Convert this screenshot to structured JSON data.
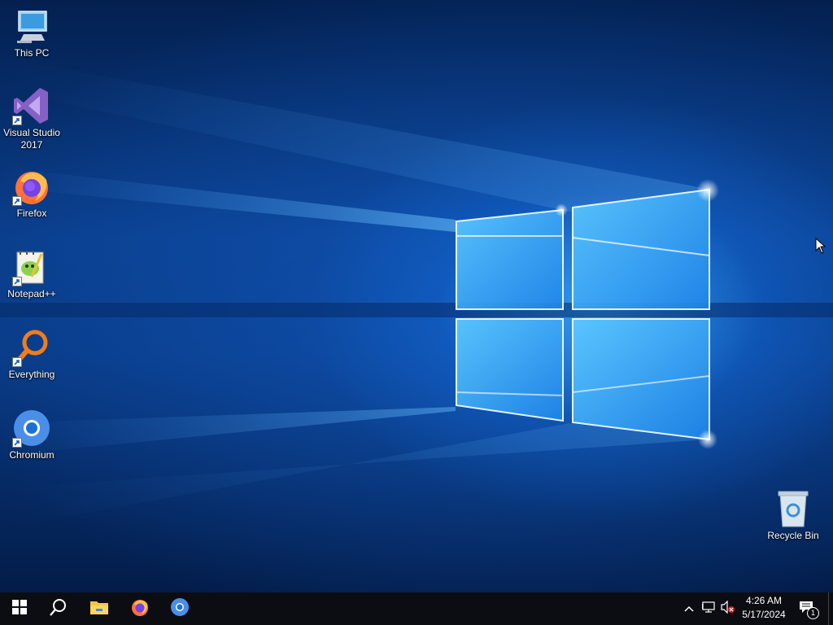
{
  "desktop": {
    "icons": [
      {
        "label": "This PC",
        "icon": "this-pc-icon"
      },
      {
        "label": "Visual Studio 2017",
        "icon": "visual-studio-icon"
      },
      {
        "label": "Firefox",
        "icon": "firefox-icon"
      },
      {
        "label": "Notepad++",
        "icon": "notepad-plus-plus-icon"
      },
      {
        "label": "Everything",
        "icon": "everything-search-icon"
      },
      {
        "label": "Chromium",
        "icon": "chromium-icon"
      }
    ],
    "recycle_bin": {
      "label": "Recycle Bin",
      "icon": "recycle-bin-icon"
    }
  },
  "taskbar": {
    "start": {
      "icon": "windows-start-icon"
    },
    "search": {
      "icon": "search-icon"
    },
    "pinned": [
      {
        "icon": "file-explorer-icon"
      },
      {
        "icon": "firefox-icon"
      },
      {
        "icon": "chromium-icon"
      }
    ],
    "tray": {
      "chevron_icon": "chevron-up-icon",
      "network_icon": "network-icon",
      "volume_icon": "volume-muted-icon",
      "time": "4:26 AM",
      "date": "5/17/2024",
      "notifications_icon": "action-center-icon",
      "notification_count": "1"
    }
  },
  "colors": {
    "wallpaper_dark": "#03214f",
    "wallpaper_light": "#3aa8ff",
    "taskbar": "#0b0d12"
  }
}
